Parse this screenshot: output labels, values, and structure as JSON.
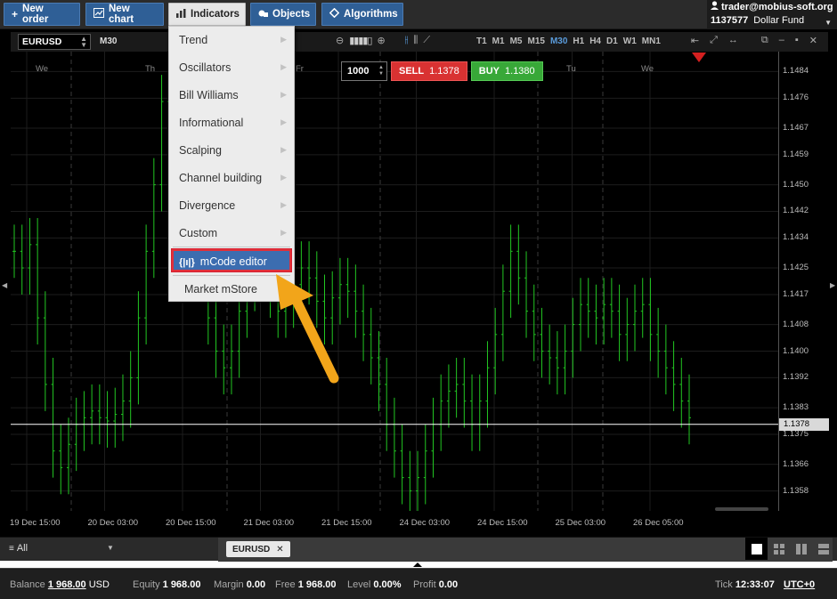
{
  "toolbar": {
    "buttons": [
      {
        "label": "New order",
        "icon": "plus-icon"
      },
      {
        "label": "New chart",
        "icon": "chart-icon"
      },
      {
        "label": "Indicators",
        "icon": "bar-chart-icon"
      },
      {
        "label": "Objects",
        "icon": "objects-icon"
      },
      {
        "label": "Algorithms",
        "icon": "diamond-icon"
      }
    ]
  },
  "account": {
    "user": "trader@mobius-soft.org",
    "number": "1137577",
    "type": "Dollar Fund"
  },
  "chart": {
    "symbol": "EURUSD",
    "timeframe": "M30",
    "timeframes": [
      "T1",
      "M1",
      "M5",
      "M15",
      "M30",
      "H1",
      "H4",
      "D1",
      "W1",
      "MN1"
    ],
    "active_timeframe": "M30",
    "day_headers": [
      "We",
      "Th",
      "Fr",
      "Tu",
      "We"
    ],
    "order": {
      "quantity": "1000",
      "sell_label": "SELL",
      "sell_price": "1.1378",
      "buy_label": "BUY",
      "buy_price": "1.1380"
    },
    "current_price": "1.1378",
    "colors": {
      "candles": "#22c722",
      "price_line": "#ffffff",
      "sell": "#d93232",
      "buy": "#38a838",
      "marker": "#d42020"
    }
  },
  "chart_data": {
    "type": "bar",
    "title": "",
    "y_ticks": [
      "1.1484",
      "1.1476",
      "1.1467",
      "1.1459",
      "1.1450",
      "1.1442",
      "1.1434",
      "1.1425",
      "1.1417",
      "1.1408",
      "1.1400",
      "1.1392",
      "1.1383",
      "1.1375",
      "1.1366",
      "1.1358"
    ],
    "x_ticks": [
      "19 Dec 15:00",
      "20 Dec 03:00",
      "20 Dec 15:00",
      "21 Dec 03:00",
      "21 Dec 15:00",
      "24 Dec 03:00",
      "24 Dec 15:00",
      "25 Dec 03:00",
      "26 Dec 05:00"
    ],
    "ylim": [
      1.1352,
      1.149
    ],
    "series": [
      {
        "values": [
          1.143,
          1.1425,
          1.1432,
          1.141,
          1.139,
          1.137,
          1.1365,
          1.1372,
          1.1378,
          1.138,
          1.1382,
          1.138,
          1.1379,
          1.1381,
          1.1385,
          1.1392,
          1.141,
          1.143,
          1.145,
          1.1475,
          1.148,
          1.1465,
          1.1455,
          1.144,
          1.1425,
          1.141,
          1.14,
          1.1395,
          1.14,
          1.1412,
          1.142,
          1.1428,
          1.1425,
          1.1418,
          1.1412,
          1.1415,
          1.142,
          1.1425,
          1.1422,
          1.1415,
          1.141,
          1.1416,
          1.142,
          1.1418,
          1.1412,
          1.1405,
          1.1398,
          1.139,
          1.1378,
          1.137,
          1.1362,
          1.1358,
          1.1362,
          1.137,
          1.1378,
          1.1385,
          1.1388,
          1.139,
          1.1385,
          1.1378,
          1.1385,
          1.1395,
          1.1405,
          1.1418,
          1.143,
          1.1422,
          1.1412,
          1.1405,
          1.14,
          1.1398,
          1.1395,
          1.14,
          1.1408,
          1.1414,
          1.1412,
          1.141,
          1.1414,
          1.1412,
          1.1405,
          1.1408,
          1.1412,
          1.1414,
          1.1405,
          1.14,
          1.1395,
          1.139,
          1.1385,
          1.138
        ]
      }
    ]
  },
  "menu": {
    "items": [
      {
        "label": "Trend",
        "submenu": true
      },
      {
        "label": "Oscillators",
        "submenu": true
      },
      {
        "label": "Bill Williams",
        "submenu": true
      },
      {
        "label": "Informational",
        "submenu": true
      },
      {
        "label": "Scalping",
        "submenu": true
      },
      {
        "label": "Channel building",
        "submenu": true
      },
      {
        "label": "Divergence",
        "submenu": true
      },
      {
        "label": "Custom",
        "submenu": true
      }
    ],
    "highlighted": {
      "label": "mCode editor",
      "icon_text": "{|ı|}"
    },
    "store": {
      "label": "Market mStore"
    }
  },
  "tabs": {
    "filter": "All",
    "open": [
      {
        "label": "EURUSD"
      }
    ]
  },
  "status": {
    "balance_label": "Balance",
    "balance": "1 968.00",
    "currency": "USD",
    "equity_label": "Equity",
    "equity": "1 968.00",
    "margin_label": "Margin",
    "margin": "0.00",
    "free_label": "Free",
    "free": "1 968.00",
    "level_label": "Level",
    "level": "0.00%",
    "profit_label": "Profit",
    "profit": "0.00",
    "tick_label": "Tick",
    "tick_time": "12:33:07",
    "timezone": "UTC+0"
  }
}
